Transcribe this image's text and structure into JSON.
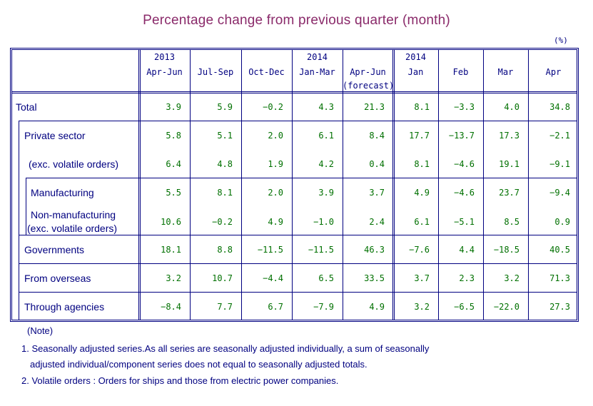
{
  "title": "Percentage change from previous quarter (month)",
  "unit": "(%)",
  "colors": {
    "title": "#8a2a6a",
    "grid": "#000080",
    "labels": "#000080",
    "values": "#007000"
  },
  "columns": [
    {
      "year": "2013",
      "period": "Apr-Jun",
      "note": ""
    },
    {
      "year": "",
      "period": "Jul-Sep",
      "note": ""
    },
    {
      "year": "",
      "period": "Oct-Dec",
      "note": ""
    },
    {
      "year": "2014",
      "period": "Jan-Mar",
      "note": ""
    },
    {
      "year": "",
      "period": "Apr-Jun",
      "note": "(forecast)"
    },
    {
      "year": "2014",
      "period": "Jan",
      "note": ""
    },
    {
      "year": "",
      "period": "Feb",
      "note": ""
    },
    {
      "year": "",
      "period": "Mar",
      "note": ""
    },
    {
      "year": "",
      "period": "Apr",
      "note": ""
    }
  ],
  "rows": [
    {
      "label": "Total",
      "label2": "",
      "values": [
        "3.9",
        "5.9",
        "−0.2",
        "4.3",
        "21.3",
        "8.1",
        "−3.3",
        "4.0",
        "34.8"
      ]
    },
    {
      "label": "Private sector",
      "label2": "",
      "values": [
        "5.8",
        "5.1",
        "2.0",
        "6.1",
        "8.4",
        "17.7",
        "−13.7",
        "17.3",
        "−2.1"
      ]
    },
    {
      "label": "(exc. volatile orders)",
      "label2": "",
      "values": [
        "6.4",
        "4.8",
        "1.9",
        "4.2",
        "0.4",
        "8.1",
        "−4.6",
        "19.1",
        "−9.1"
      ]
    },
    {
      "label": "Manufacturing",
      "label2": "",
      "values": [
        "5.5",
        "8.1",
        "2.0",
        "3.9",
        "3.7",
        "4.9",
        "−4.6",
        "23.7",
        "−9.4"
      ]
    },
    {
      "label": "Non-manufacturing",
      "label2": "(exc. volatile orders)",
      "values": [
        "10.6",
        "−0.2",
        "4.9",
        "−1.0",
        "2.4",
        "6.1",
        "−5.1",
        "8.5",
        "0.9"
      ]
    },
    {
      "label": "Governments",
      "label2": "",
      "values": [
        "18.1",
        "8.8",
        "−11.5",
        "−11.5",
        "46.3",
        "−7.6",
        "4.4",
        "−18.5",
        "40.5"
      ]
    },
    {
      "label": "From overseas",
      "label2": "",
      "values": [
        "3.2",
        "10.7",
        "−4.4",
        "6.5",
        "33.5",
        "3.7",
        "2.3",
        "3.2",
        "71.3"
      ]
    },
    {
      "label": "Through agencies",
      "label2": "",
      "values": [
        "−8.4",
        "7.7",
        "6.7",
        "−7.9",
        "4.9",
        "3.2",
        "−6.5",
        "−22.0",
        "27.3"
      ]
    }
  ],
  "notes": {
    "heading": "(Note)",
    "lines": [
      "1. Seasonally adjusted series.As all series are seasonally adjusted individually,  a sum of seasonally",
      "   adjusted individual/component series does not equal to seasonally adjusted totals.",
      "2. Volatile orders : Orders for ships and those from electric power companies."
    ]
  }
}
